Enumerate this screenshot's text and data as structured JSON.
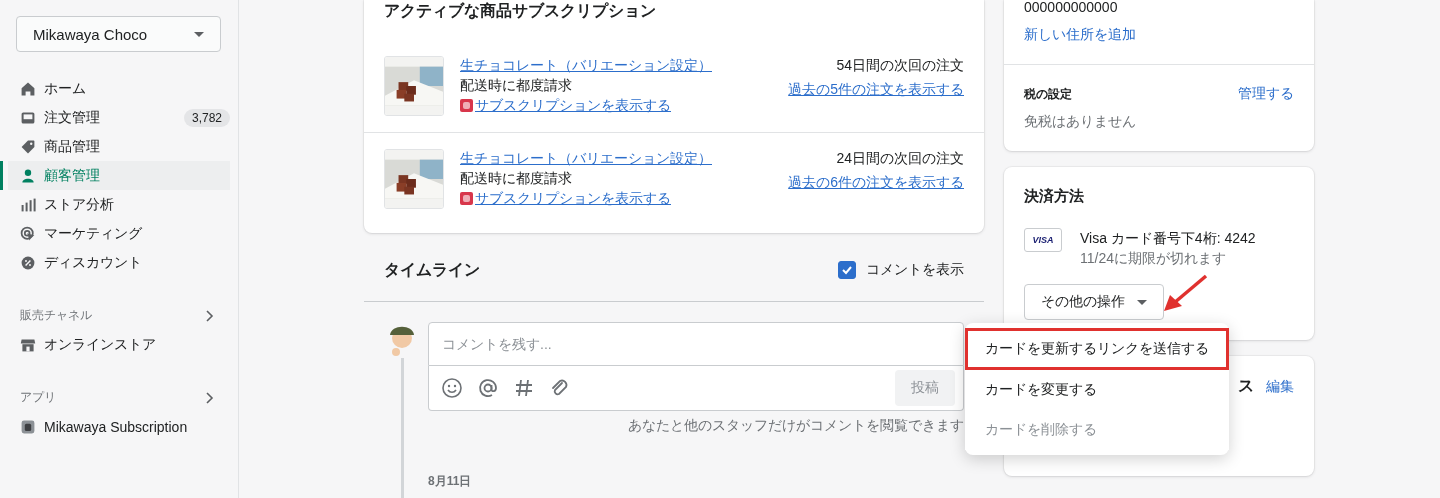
{
  "sidebar": {
    "store": "Mikawaya Choco",
    "nav": [
      {
        "label": "ホーム",
        "selected": false
      },
      {
        "label": "注文管理",
        "badge": "3,782",
        "selected": false
      },
      {
        "label": "商品管理",
        "selected": false
      },
      {
        "label": "顧客管理",
        "selected": true
      },
      {
        "label": "ストア分析",
        "selected": false
      },
      {
        "label": "マーケティング",
        "selected": false
      },
      {
        "label": "ディスカウント",
        "selected": false
      }
    ],
    "sections": [
      {
        "title": "販売チャネル",
        "items": [
          {
            "label": "オンラインストア"
          }
        ]
      },
      {
        "title": "アプリ",
        "items": [
          {
            "label": "Mikawaya Subscription"
          }
        ]
      }
    ]
  },
  "subscriptions": {
    "title": "アクティブな商品サブスクリプション",
    "items": [
      {
        "kind": "picture",
        "product": "生チョコレート（バリエーション設定）",
        "billing": "配送時に都度請求",
        "link": "サブスクリプションを表示する",
        "next": "54日間の次回の注文",
        "orders": "過去の5件の注文を表示する"
      },
      {
        "kind": "picture",
        "product": "生チョコレート（バリエーション設定）",
        "billing": "配送時に都度請求",
        "link": "サブスクリプションを表示する",
        "next": "24日間の次回の注文",
        "orders": "過去の6件の注文を表示する"
      }
    ]
  },
  "timeline": {
    "title": "タイムライン",
    "show_comments": {
      "label": "コメントを表示",
      "checked": true
    },
    "comment": {
      "placeholder": "コメントを残す...",
      "post": {
        "label": "投稿",
        "disabled": true
      }
    },
    "hint": "あなたと他のスタッフだけがコメントを閲覧できます",
    "date": "8月11日"
  },
  "contact": {
    "phone": "000000000000",
    "add_address": "新しい住所を追加",
    "tax_title": "税の設定",
    "tax_action": "管理する",
    "tax_value": "免税はありません"
  },
  "payment": {
    "title": "決済方法",
    "card_brand": "VISA",
    "card": "Visa カード番号下4桁: 4242",
    "expiry": "11/24に期限が切れます",
    "actions": "その他の操作"
  },
  "next_card": {
    "title": "ス",
    "action": "編集"
  },
  "menu": [
    {
      "label": "カードを更新するリンクを送信する",
      "disabled": false,
      "annotated": true
    },
    {
      "label": "カードを変更する",
      "disabled": false,
      "annotated": false
    },
    {
      "label": "カードを削除する",
      "disabled": true,
      "annotated": false
    }
  ]
}
